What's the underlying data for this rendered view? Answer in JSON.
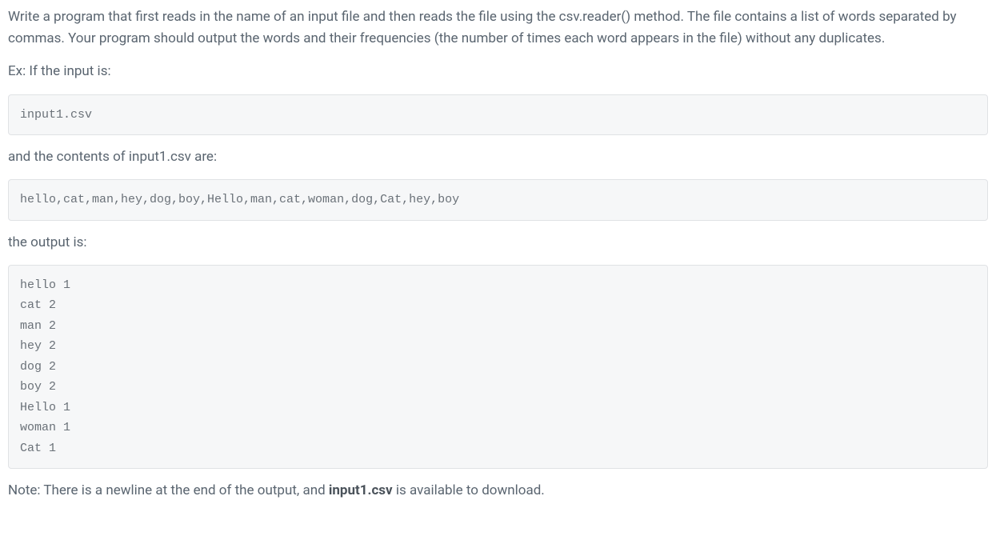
{
  "intro": "Write a program that first reads in the name of an input file and then reads the file using the csv.reader() method. The file contains a list of words separated by commas. Your program should output the words and their frequencies (the number of times each word appears in the file) without any duplicates.",
  "ex_label": "Ex: If the input is:",
  "input_filename": "input1.csv",
  "contents_label": "and the contents of input1.csv are:",
  "csv_contents": "hello,cat,man,hey,dog,boy,Hello,man,cat,woman,dog,Cat,hey,boy",
  "output_label": "the output is:",
  "output_block": "hello 1\ncat 2\nman 2\nhey 2\ndog 2\nboy 2\nHello 1\nwoman 1\nCat 1",
  "note_prefix": "Note: There is a newline at the end of the output, and ",
  "note_bold": "input1.csv",
  "note_suffix": " is available to download."
}
